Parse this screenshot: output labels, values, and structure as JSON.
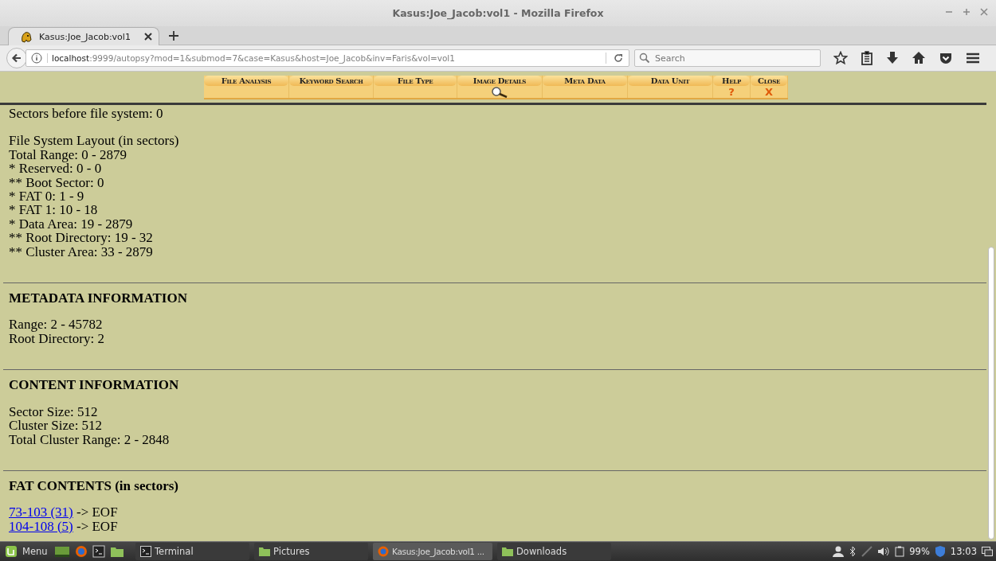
{
  "window": {
    "title": "Kasus:Joe_Jacob:vol1 - Mozilla Firefox"
  },
  "tabs": [
    {
      "label": "Kasus:Joe_Jacob:vol1"
    }
  ],
  "address_bar": {
    "host": "localhost",
    "path": ":9999/autopsy?mod=1&submod=7&case=Kasus&host=Joe_Jacob&inv=Faris&vol=vol1"
  },
  "search": {
    "placeholder": "Search"
  },
  "toolbar": [
    {
      "label": "File Analysis",
      "selected": false
    },
    {
      "label": "Keyword Search",
      "selected": false
    },
    {
      "label": "File Type",
      "selected": false
    },
    {
      "label": "Image Details",
      "selected": true
    },
    {
      "label": "Meta Data",
      "selected": false
    },
    {
      "label": "Data Unit",
      "selected": false
    },
    {
      "label": "Help",
      "selected": false,
      "mark": "?"
    },
    {
      "label": "Close",
      "selected": false,
      "mark": "X"
    }
  ],
  "content": {
    "intro": [
      "Sectors before file system: 0"
    ],
    "layout": [
      "File System Layout (in sectors)",
      "Total Range: 0 - 2879",
      "* Reserved: 0 - 0",
      "** Boot Sector: 0",
      "* FAT 0: 1 - 9",
      "* FAT 1: 10 - 18",
      "* Data Area: 19 - 2879",
      "** Root Directory: 19 - 32",
      "** Cluster Area: 33 - 2879"
    ],
    "sections": [
      {
        "heading": "METADATA INFORMATION",
        "lines": [
          "Range: 2 - 45782",
          "Root Directory: 2"
        ]
      },
      {
        "heading": "CONTENT INFORMATION",
        "lines": [
          "Sector Size: 512",
          "Cluster Size: 512",
          "Total Cluster Range: 2 - 2848"
        ]
      },
      {
        "heading": "FAT CONTENTS (in sectors)",
        "links": [
          {
            "link": "73-103 (31)",
            "text": "-> EOF"
          },
          {
            "link": "104-108 (5)",
            "text": "-> EOF"
          }
        ]
      }
    ]
  },
  "taskbar": {
    "menu": "Menu",
    "windows": [
      {
        "label": "Terminal",
        "kind": "terminal",
        "selected": false
      },
      {
        "label": "Pictures",
        "kind": "folder",
        "selected": false
      },
      {
        "label": "Kasus:Joe_Jacob:vol1 ...",
        "kind": "browser",
        "selected": true
      },
      {
        "label": "Downloads",
        "kind": "folder",
        "selected": false
      }
    ],
    "battery": "99%",
    "clock": "13:03"
  }
}
